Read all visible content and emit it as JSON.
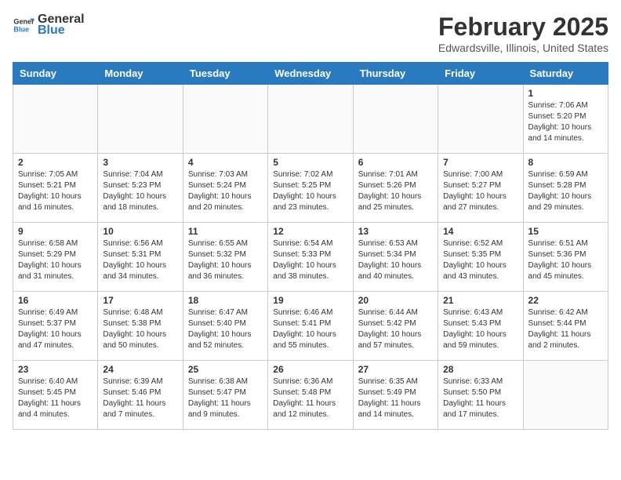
{
  "header": {
    "logo_general": "General",
    "logo_blue": "Blue",
    "month_year": "February 2025",
    "location": "Edwardsville, Illinois, United States"
  },
  "days_of_week": [
    "Sunday",
    "Monday",
    "Tuesday",
    "Wednesday",
    "Thursday",
    "Friday",
    "Saturday"
  ],
  "weeks": [
    [
      {
        "day": "",
        "info": ""
      },
      {
        "day": "",
        "info": ""
      },
      {
        "day": "",
        "info": ""
      },
      {
        "day": "",
        "info": ""
      },
      {
        "day": "",
        "info": ""
      },
      {
        "day": "",
        "info": ""
      },
      {
        "day": "1",
        "info": "Sunrise: 7:06 AM\nSunset: 5:20 PM\nDaylight: 10 hours and 14 minutes."
      }
    ],
    [
      {
        "day": "2",
        "info": "Sunrise: 7:05 AM\nSunset: 5:21 PM\nDaylight: 10 hours and 16 minutes."
      },
      {
        "day": "3",
        "info": "Sunrise: 7:04 AM\nSunset: 5:23 PM\nDaylight: 10 hours and 18 minutes."
      },
      {
        "day": "4",
        "info": "Sunrise: 7:03 AM\nSunset: 5:24 PM\nDaylight: 10 hours and 20 minutes."
      },
      {
        "day": "5",
        "info": "Sunrise: 7:02 AM\nSunset: 5:25 PM\nDaylight: 10 hours and 23 minutes."
      },
      {
        "day": "6",
        "info": "Sunrise: 7:01 AM\nSunset: 5:26 PM\nDaylight: 10 hours and 25 minutes."
      },
      {
        "day": "7",
        "info": "Sunrise: 7:00 AM\nSunset: 5:27 PM\nDaylight: 10 hours and 27 minutes."
      },
      {
        "day": "8",
        "info": "Sunrise: 6:59 AM\nSunset: 5:28 PM\nDaylight: 10 hours and 29 minutes."
      }
    ],
    [
      {
        "day": "9",
        "info": "Sunrise: 6:58 AM\nSunset: 5:29 PM\nDaylight: 10 hours and 31 minutes."
      },
      {
        "day": "10",
        "info": "Sunrise: 6:56 AM\nSunset: 5:31 PM\nDaylight: 10 hours and 34 minutes."
      },
      {
        "day": "11",
        "info": "Sunrise: 6:55 AM\nSunset: 5:32 PM\nDaylight: 10 hours and 36 minutes."
      },
      {
        "day": "12",
        "info": "Sunrise: 6:54 AM\nSunset: 5:33 PM\nDaylight: 10 hours and 38 minutes."
      },
      {
        "day": "13",
        "info": "Sunrise: 6:53 AM\nSunset: 5:34 PM\nDaylight: 10 hours and 40 minutes."
      },
      {
        "day": "14",
        "info": "Sunrise: 6:52 AM\nSunset: 5:35 PM\nDaylight: 10 hours and 43 minutes."
      },
      {
        "day": "15",
        "info": "Sunrise: 6:51 AM\nSunset: 5:36 PM\nDaylight: 10 hours and 45 minutes."
      }
    ],
    [
      {
        "day": "16",
        "info": "Sunrise: 6:49 AM\nSunset: 5:37 PM\nDaylight: 10 hours and 47 minutes."
      },
      {
        "day": "17",
        "info": "Sunrise: 6:48 AM\nSunset: 5:38 PM\nDaylight: 10 hours and 50 minutes."
      },
      {
        "day": "18",
        "info": "Sunrise: 6:47 AM\nSunset: 5:40 PM\nDaylight: 10 hours and 52 minutes."
      },
      {
        "day": "19",
        "info": "Sunrise: 6:46 AM\nSunset: 5:41 PM\nDaylight: 10 hours and 55 minutes."
      },
      {
        "day": "20",
        "info": "Sunrise: 6:44 AM\nSunset: 5:42 PM\nDaylight: 10 hours and 57 minutes."
      },
      {
        "day": "21",
        "info": "Sunrise: 6:43 AM\nSunset: 5:43 PM\nDaylight: 10 hours and 59 minutes."
      },
      {
        "day": "22",
        "info": "Sunrise: 6:42 AM\nSunset: 5:44 PM\nDaylight: 11 hours and 2 minutes."
      }
    ],
    [
      {
        "day": "23",
        "info": "Sunrise: 6:40 AM\nSunset: 5:45 PM\nDaylight: 11 hours and 4 minutes."
      },
      {
        "day": "24",
        "info": "Sunrise: 6:39 AM\nSunset: 5:46 PM\nDaylight: 11 hours and 7 minutes."
      },
      {
        "day": "25",
        "info": "Sunrise: 6:38 AM\nSunset: 5:47 PM\nDaylight: 11 hours and 9 minutes."
      },
      {
        "day": "26",
        "info": "Sunrise: 6:36 AM\nSunset: 5:48 PM\nDaylight: 11 hours and 12 minutes."
      },
      {
        "day": "27",
        "info": "Sunrise: 6:35 AM\nSunset: 5:49 PM\nDaylight: 11 hours and 14 minutes."
      },
      {
        "day": "28",
        "info": "Sunrise: 6:33 AM\nSunset: 5:50 PM\nDaylight: 11 hours and 17 minutes."
      },
      {
        "day": "",
        "info": ""
      }
    ]
  ]
}
